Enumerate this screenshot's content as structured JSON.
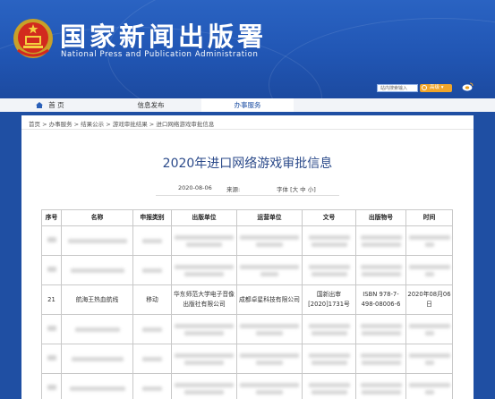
{
  "header": {
    "logo_cn": "国家新闻出版署",
    "logo_en": "National Press and Publication Administration",
    "search_placeholder": "站内搜索输入",
    "search_button": "高级"
  },
  "nav": {
    "items": [
      {
        "label": "首 页"
      },
      {
        "label": "信息发布"
      },
      {
        "label": "办事服务"
      }
    ]
  },
  "breadcrumb": "首页 > 办事服务 > 结果公示 > 游戏审批结果 > 进口网络游戏审批信息",
  "article": {
    "title": "2020年进口网络游戏审批信息",
    "date": "2020-08-06",
    "source_label": "来源:",
    "font_size_label": "字体 [大 中 小]"
  },
  "table": {
    "headers": [
      "序号",
      "名称",
      "申报类别",
      "出版单位",
      "运营单位",
      "文号",
      "出版物号",
      "时间"
    ],
    "visible_row": {
      "no": "21",
      "name": "航海王热血航线",
      "category": "移动",
      "publisher": "华东师范大学电子音像出版社有限公司",
      "operator": "成都卓星科技有限公司",
      "approval_no": "国新出审[2020]1731号",
      "isbn": "ISBN 978-7-498-08006-6",
      "date": "2020年08月06日"
    }
  },
  "colors": {
    "header_blue": "#2156b4",
    "title_blue": "#2b4a8a",
    "search_orange": "#f0a52a"
  }
}
